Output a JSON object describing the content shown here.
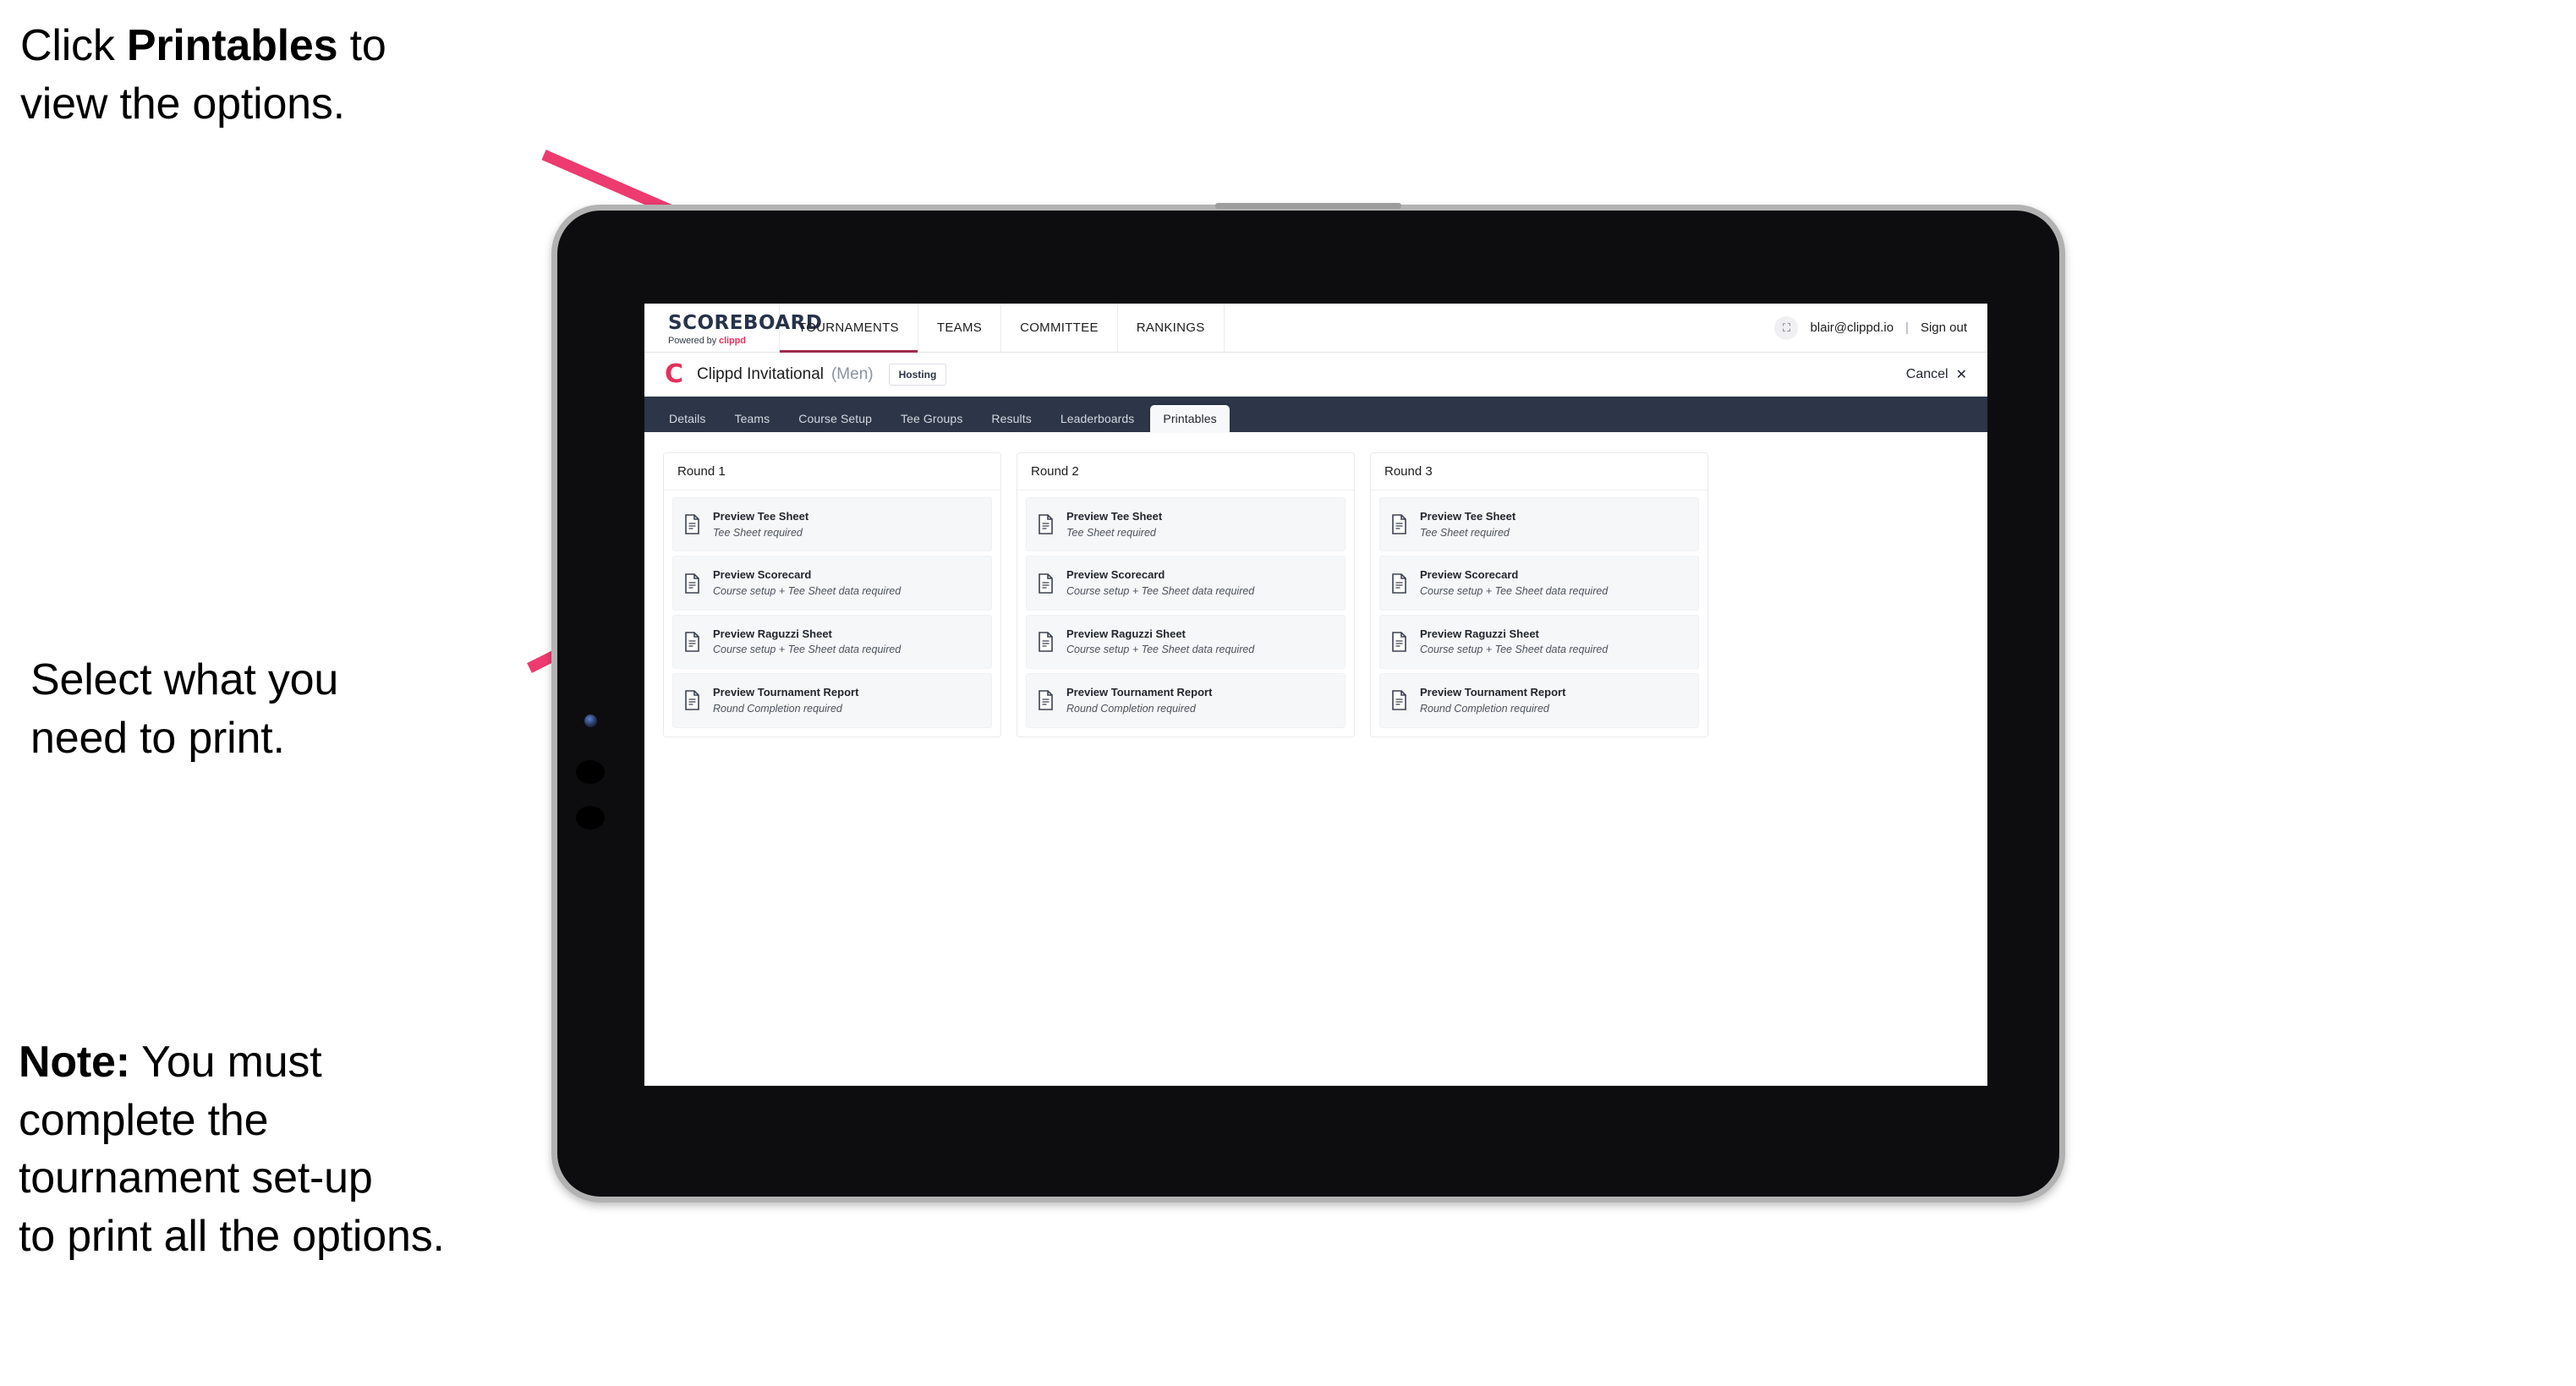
{
  "annotations": {
    "top": {
      "before": "Click ",
      "bold": "Printables",
      "after": " to\nview the options."
    },
    "middle": {
      "text": "Select what you\n need to print."
    },
    "note": {
      "bold": "Note:",
      "text": " You must\ncomplete the\ntournament set-up\nto print all the options."
    }
  },
  "colors": {
    "arrow_pink": "#ed3b6f",
    "brand_pink": "#e8305f",
    "navbar_dark": "#2c3648",
    "active_underline": "#9e2b4c"
  },
  "app": {
    "logo": {
      "word": "SCOREBOARD",
      "sub_prefix": "Powered by ",
      "sub_brand": "clippd"
    },
    "topnav": [
      {
        "label": "TOURNAMENTS",
        "active": true
      },
      {
        "label": "TEAMS",
        "active": false
      },
      {
        "label": "COMMITTEE",
        "active": false
      },
      {
        "label": "RANKINGS",
        "active": false
      }
    ],
    "user": {
      "avatar_glyph": "⛶",
      "email": "blair@clippd.io",
      "separator": "|",
      "signout": "Sign out"
    },
    "tournament": {
      "logo_letter": "C",
      "name": "Clippd Invitational",
      "gender": "(Men)",
      "badge": "Hosting",
      "cancel_label": "Cancel",
      "cancel_icon": "✕"
    },
    "tabs": [
      {
        "label": "Details",
        "active": false
      },
      {
        "label": "Teams",
        "active": false
      },
      {
        "label": "Course Setup",
        "active": false
      },
      {
        "label": "Tee Groups",
        "active": false
      },
      {
        "label": "Results",
        "active": false
      },
      {
        "label": "Leaderboards",
        "active": false
      },
      {
        "label": "Printables",
        "active": true
      }
    ],
    "rounds": [
      {
        "title": "Round 1",
        "items": [
          {
            "title": "Preview Tee Sheet",
            "sub": "Tee Sheet required"
          },
          {
            "title": "Preview Scorecard",
            "sub": "Course setup + Tee Sheet data required"
          },
          {
            "title": "Preview Raguzzi Sheet",
            "sub": "Course setup + Tee Sheet data required"
          },
          {
            "title": "Preview Tournament Report",
            "sub": "Round Completion required"
          }
        ]
      },
      {
        "title": "Round 2",
        "items": [
          {
            "title": "Preview Tee Sheet",
            "sub": "Tee Sheet required"
          },
          {
            "title": "Preview Scorecard",
            "sub": "Course setup + Tee Sheet data required"
          },
          {
            "title": "Preview Raguzzi Sheet",
            "sub": "Course setup + Tee Sheet data required"
          },
          {
            "title": "Preview Tournament Report",
            "sub": "Round Completion required"
          }
        ]
      },
      {
        "title": "Round 3",
        "items": [
          {
            "title": "Preview Tee Sheet",
            "sub": "Tee Sheet required"
          },
          {
            "title": "Preview Scorecard",
            "sub": "Course setup + Tee Sheet data required"
          },
          {
            "title": "Preview Raguzzi Sheet",
            "sub": "Course setup + Tee Sheet data required"
          },
          {
            "title": "Preview Tournament Report",
            "sub": "Round Completion required"
          }
        ]
      }
    ]
  }
}
